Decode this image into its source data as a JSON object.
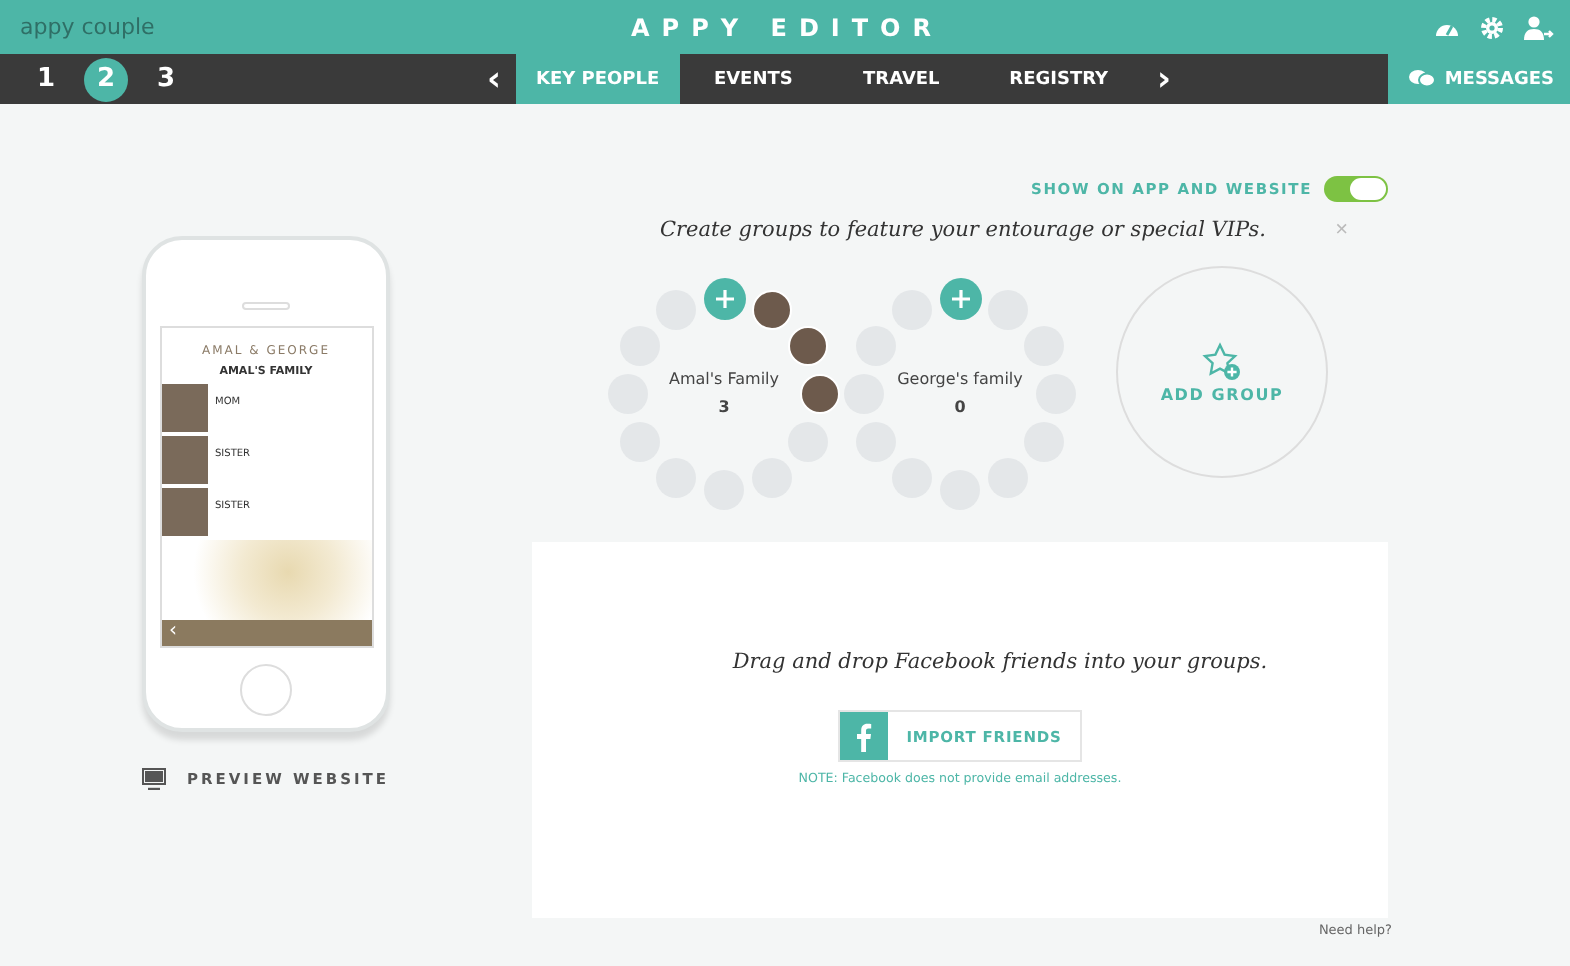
{
  "header": {
    "logo": "appy couple",
    "title": "APPY EDITOR"
  },
  "steps": [
    {
      "label": "1",
      "selected": false
    },
    {
      "label": "2",
      "selected": true
    },
    {
      "label": "3",
      "selected": false
    }
  ],
  "nav": {
    "prev": "‹",
    "next": "›",
    "tabs": [
      {
        "label": "KEY PEOPLE",
        "selected": true
      },
      {
        "label": "EVENTS",
        "selected": false
      },
      {
        "label": "TRAVEL",
        "selected": false
      },
      {
        "label": "REGISTRY",
        "selected": false
      }
    ],
    "messages": "MESSAGES"
  },
  "preview": {
    "couple": "AMAL & GEORGE",
    "group": "AMAL'S FAMILY",
    "members": [
      {
        "role": "MOM"
      },
      {
        "role": "SISTER"
      },
      {
        "role": "SISTER"
      }
    ],
    "back": "‹",
    "link": "PREVIEW WEBSITE"
  },
  "toggle": {
    "label": "SHOW ON APP AND WEBSITE",
    "on": true
  },
  "intro": "Create groups to feature your entourage or special VIPs.",
  "close": "×",
  "groups": [
    {
      "kind": "group",
      "name": "Amal's Family",
      "count": "3",
      "photos": [
        {
          "kind": "photo"
        },
        {
          "kind": "photo"
        },
        {
          "kind": "photo"
        }
      ]
    },
    {
      "kind": "group",
      "name": "George's family",
      "count": "0"
    },
    {
      "kind": "add",
      "name": "ADD GROUP"
    }
  ],
  "import": {
    "prompt": "Drag and drop Facebook friends into your groups.",
    "button": "IMPORT FRIENDS",
    "note": "NOTE: Facebook does not provide email addresses."
  },
  "help": "Need help?"
}
